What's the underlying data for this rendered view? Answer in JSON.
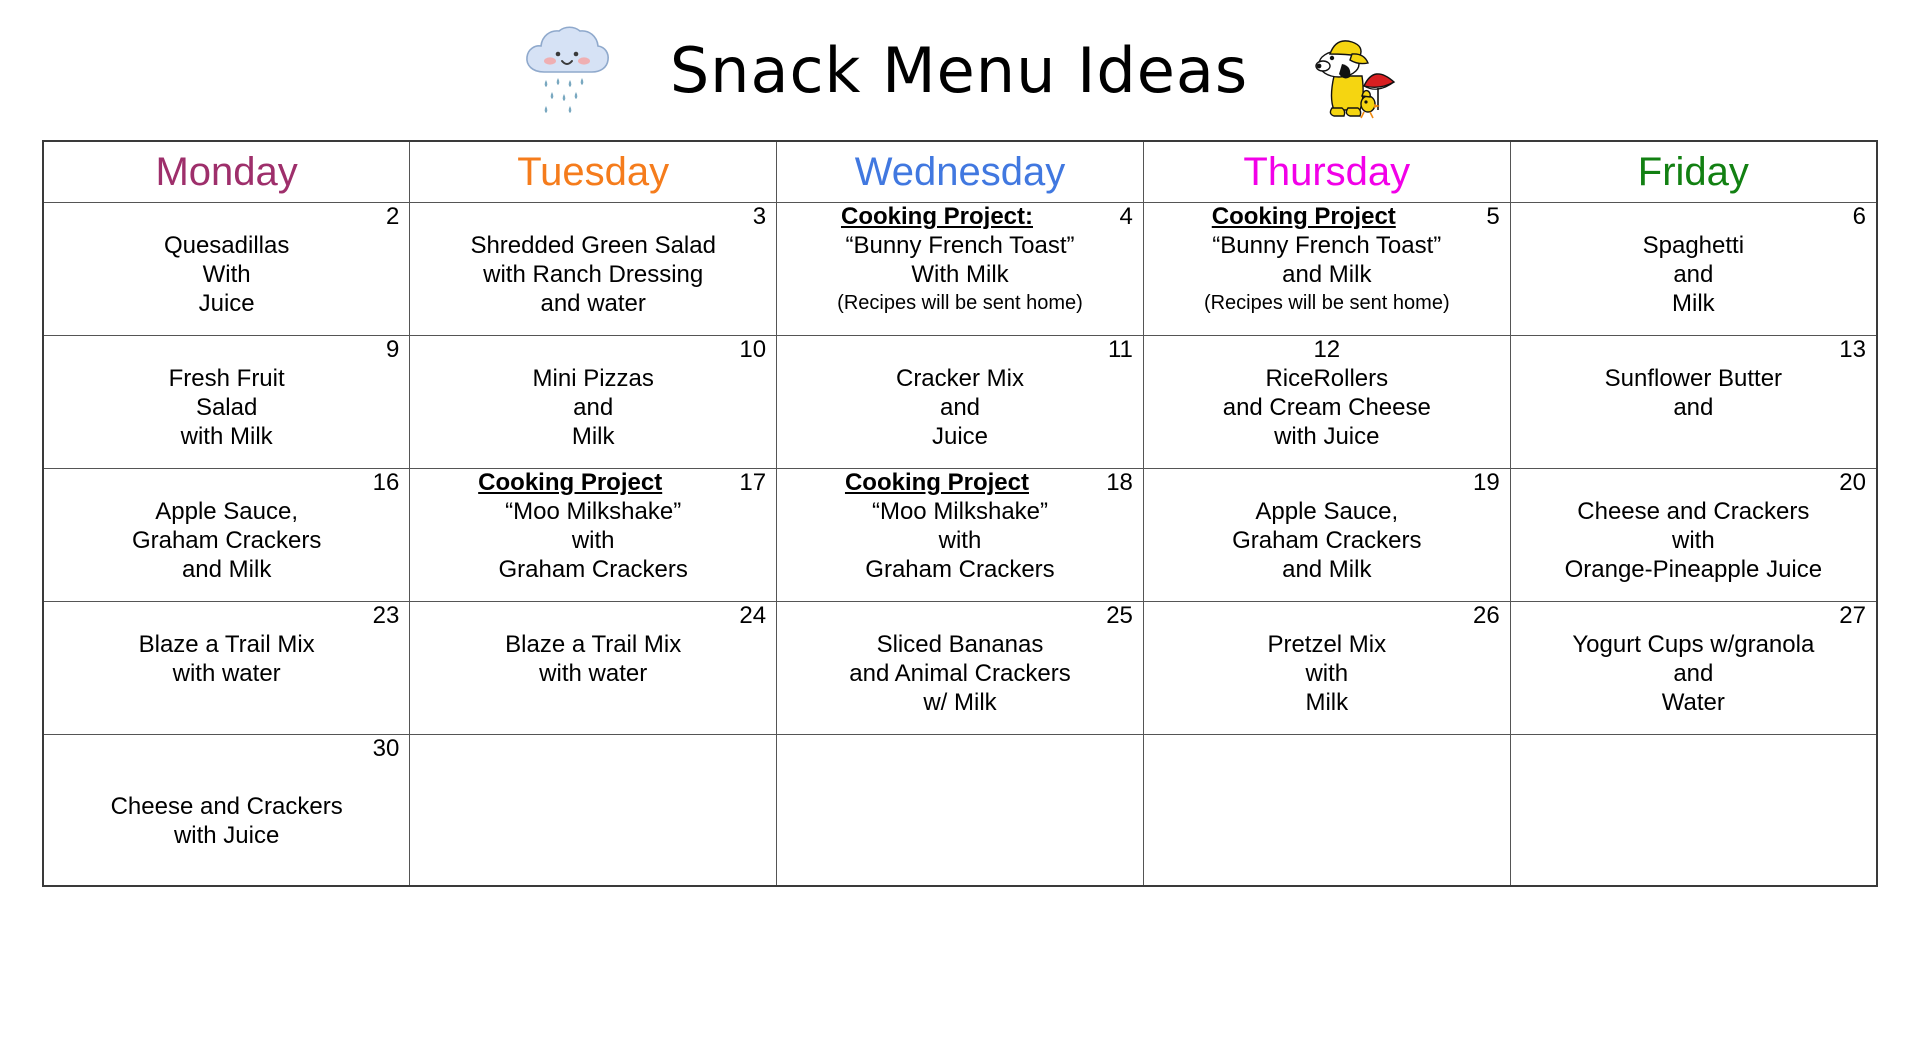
{
  "header": {
    "title": "Snack Menu Ideas",
    "left_icon": "rain-cloud-icon",
    "right_icon": "snoopy-raincoat-icon"
  },
  "calendar": {
    "day_headers": [
      {
        "label": "Monday",
        "color": "#9E2F6B"
      },
      {
        "label": "Tuesday",
        "color": "#F57C1C"
      },
      {
        "label": "Wednesday",
        "color": "#4178E0"
      },
      {
        "label": "Thursday",
        "color": "#F200E8"
      },
      {
        "label": "Friday",
        "color": "#128012"
      }
    ],
    "weeks": [
      [
        {
          "date": "2",
          "date_align": "right",
          "project": "",
          "lines": [
            "Quesadillas",
            "With",
            "Juice"
          ],
          "note": ""
        },
        {
          "date": "3",
          "date_align": "right",
          "project": "",
          "lines": [
            "Shredded Green Salad",
            "with Ranch Dressing",
            "and water"
          ],
          "note": ""
        },
        {
          "date": "4",
          "date_align": "right",
          "project": "Cooking Project:",
          "lines": [
            "“Bunny French Toast”",
            "With Milk"
          ],
          "note": "(Recipes will be sent home)"
        },
        {
          "date": "5",
          "date_align": "right",
          "project": "Cooking Project",
          "lines": [
            "“Bunny French Toast”",
            "and Milk"
          ],
          "note": "(Recipes will be sent home)"
        },
        {
          "date": "6",
          "date_align": "right",
          "project": "",
          "lines": [
            "Spaghetti",
            "and",
            "Milk"
          ],
          "note": ""
        }
      ],
      [
        {
          "date": "9",
          "date_align": "right",
          "project": "",
          "lines": [
            "Fresh Fruit",
            "Salad",
            "with Milk"
          ],
          "note": ""
        },
        {
          "date": "10",
          "date_align": "right",
          "project": "",
          "lines": [
            "Mini Pizzas",
            "and",
            "Milk"
          ],
          "note": ""
        },
        {
          "date": "11",
          "date_align": "right",
          "project": "",
          "lines": [
            "Cracker Mix",
            "and",
            "Juice"
          ],
          "note": ""
        },
        {
          "date": "12",
          "date_align": "center",
          "project": "",
          "lines": [
            "RiceRollers",
            "and Cream Cheese",
            "with Juice"
          ],
          "note": ""
        },
        {
          "date": "13",
          "date_align": "right",
          "project": "",
          "lines": [
            "Sunflower Butter",
            "and"
          ],
          "note": ""
        }
      ],
      [
        {
          "date": "16",
          "date_align": "right",
          "project": "",
          "lines": [
            "Apple Sauce,",
            "Graham Crackers",
            "and Milk"
          ],
          "note": ""
        },
        {
          "date": "17",
          "date_align": "right",
          "project": "Cooking Project",
          "lines": [
            "“Moo Milkshake”",
            "with",
            "Graham Crackers"
          ],
          "note": ""
        },
        {
          "date": "18",
          "date_align": "right",
          "project": "Cooking Project",
          "lines": [
            "“Moo Milkshake”",
            "with",
            "Graham Crackers"
          ],
          "note": ""
        },
        {
          "date": "19",
          "date_align": "right",
          "project": "",
          "lines": [
            "Apple Sauce,",
            "Graham Crackers",
            "and Milk"
          ],
          "note": ""
        },
        {
          "date": "20",
          "date_align": "right",
          "project": "",
          "lines": [
            "Cheese and Crackers",
            "with",
            "Orange-Pineapple Juice"
          ],
          "note": ""
        }
      ],
      [
        {
          "date": "23",
          "date_align": "right",
          "project": "",
          "lines": [
            "Blaze a Trail Mix",
            "with water"
          ],
          "note": ""
        },
        {
          "date": "24",
          "date_align": "right",
          "project": "",
          "lines": [
            "Blaze a Trail Mix",
            "with water"
          ],
          "note": ""
        },
        {
          "date": "25",
          "date_align": "right",
          "project": "",
          "lines": [
            "Sliced Bananas",
            "and Animal Crackers",
            "w/ Milk"
          ],
          "note": ""
        },
        {
          "date": "26",
          "date_align": "right",
          "project": "",
          "lines": [
            "Pretzel Mix",
            "with",
            "Milk"
          ],
          "note": ""
        },
        {
          "date": "27",
          "date_align": "right",
          "project": "",
          "lines": [
            "Yogurt Cups w/granola",
            "and",
            "Water"
          ],
          "note": ""
        }
      ],
      [
        {
          "date": "30",
          "date_align": "right",
          "project": "",
          "lines": [
            "",
            "Cheese and Crackers",
            "with Juice"
          ],
          "note": ""
        },
        {
          "date": "",
          "date_align": "right",
          "project": "",
          "lines": [],
          "note": ""
        },
        {
          "date": "",
          "date_align": "right",
          "project": "",
          "lines": [],
          "note": ""
        },
        {
          "date": "",
          "date_align": "right",
          "project": "",
          "lines": [],
          "note": ""
        },
        {
          "date": "",
          "date_align": "right",
          "project": "",
          "lines": [],
          "note": ""
        }
      ]
    ]
  }
}
